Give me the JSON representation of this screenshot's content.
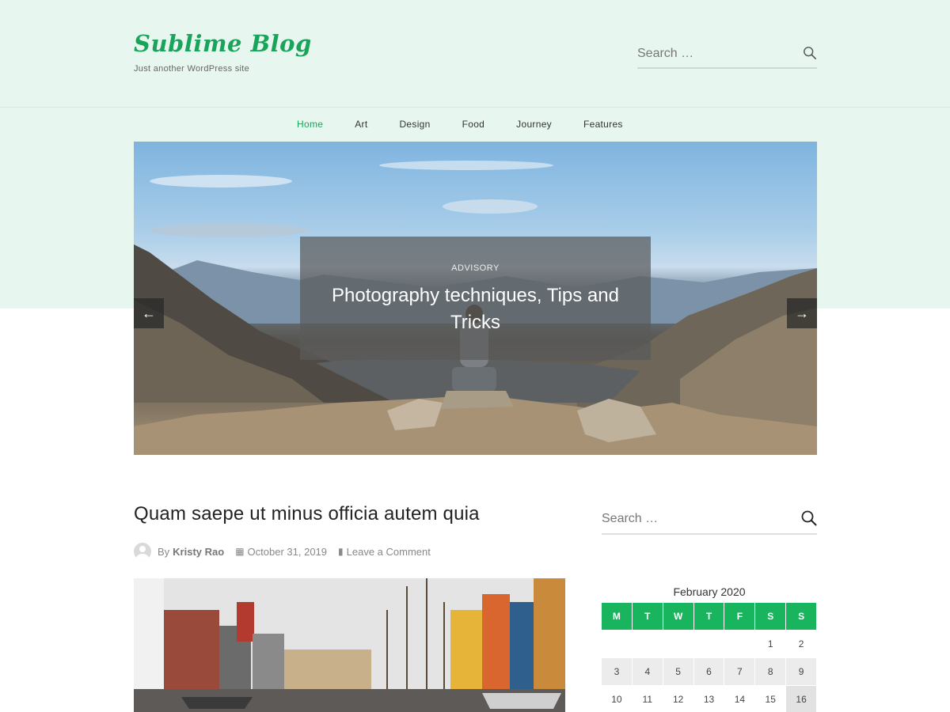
{
  "site": {
    "title": "Sublime Blog",
    "tagline": "Just another WordPress site"
  },
  "header_search": {
    "placeholder": "Search …",
    "icon": "search-icon"
  },
  "nav": {
    "items": [
      {
        "label": "Home",
        "active": true
      },
      {
        "label": "Art",
        "active": false
      },
      {
        "label": "Design",
        "active": false
      },
      {
        "label": "Food",
        "active": false
      },
      {
        "label": "Journey",
        "active": false
      },
      {
        "label": "Features",
        "active": false
      }
    ]
  },
  "slider": {
    "category": "ADVISORY",
    "title": "Photography techniques, Tips and Tricks",
    "prev_icon": "arrow-left-icon",
    "next_icon": "arrow-right-icon"
  },
  "post": {
    "title": "Quam saepe ut minus officia autem quia",
    "by": "By",
    "author": "Kristy Rao",
    "date": "October 31, 2019",
    "comment": "Leave a Comment"
  },
  "sidebar_search": {
    "placeholder": "Search …",
    "icon": "search-icon"
  },
  "calendar": {
    "caption": "February 2020",
    "headers": [
      "M",
      "T",
      "W",
      "T",
      "F",
      "S",
      "S"
    ],
    "rows": [
      [
        "",
        "",
        "",
        "",
        "",
        "1",
        "2"
      ],
      [
        "3",
        "4",
        "5",
        "6",
        "7",
        "8",
        "9"
      ],
      [
        "10",
        "11",
        "12",
        "13",
        "14",
        "15",
        "16"
      ]
    ]
  },
  "colors": {
    "accent": "#19a45a",
    "header_bg": "#e7f6ef"
  }
}
